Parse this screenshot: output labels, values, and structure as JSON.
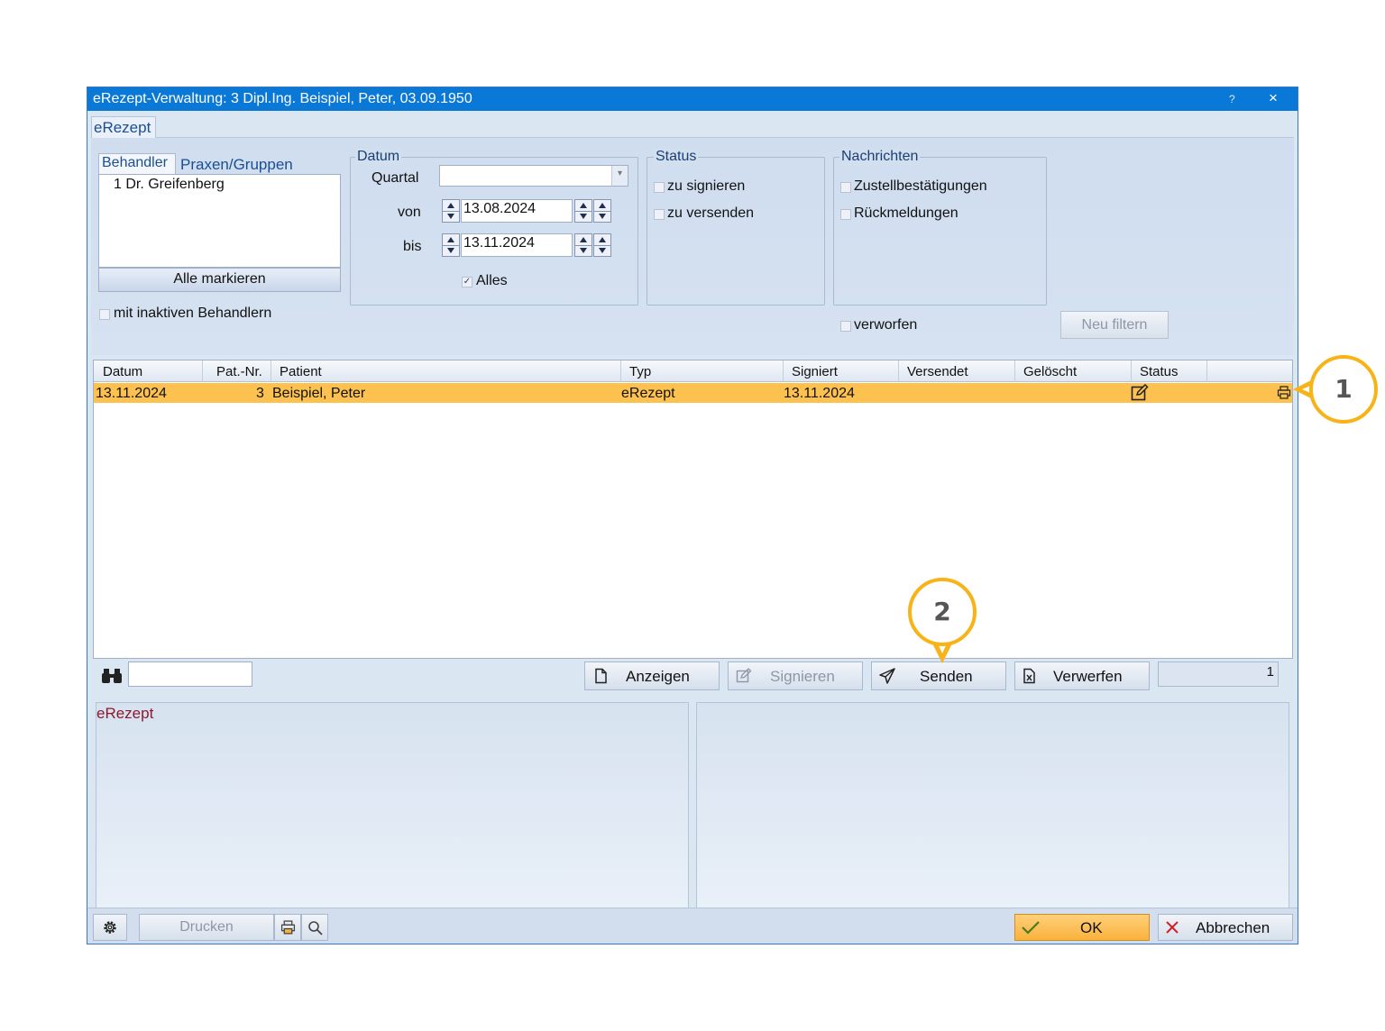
{
  "window": {
    "title": "eRezept-Verwaltung: 3 Dipl.Ing. Beispiel, Peter, 03.09.1950",
    "help": "?",
    "close": "×"
  },
  "main_tab": "eRezept",
  "behandler": {
    "tab_active": "Behandler",
    "tab_other": "Praxen/Gruppen",
    "items": [
      "1  Dr. Greifenberg"
    ],
    "select_all": "Alle markieren",
    "inactive_label": "mit inaktiven Behandlern"
  },
  "datum": {
    "legend": "Datum",
    "quartal_label": "Quartal",
    "quartal_value": "",
    "von_label": "von",
    "von_value": "13.08.2024",
    "bis_label": "bis",
    "bis_value": "13.11.2024",
    "alles_label": "Alles",
    "alles_checked": true
  },
  "status": {
    "legend": "Status",
    "options": [
      "zu signieren",
      "zu versenden"
    ]
  },
  "nachrichten": {
    "legend": "Nachrichten",
    "options": [
      "Zustellbestätigungen",
      "Rückmeldungen"
    ]
  },
  "verworfen_label": "verworfen",
  "neu_filtern": "Neu filtern",
  "table": {
    "columns": [
      "Datum",
      "Pat.-Nr.",
      "Patient",
      "Typ",
      "Signiert",
      "Versendet",
      "Gelöscht",
      "Status"
    ],
    "rows": [
      {
        "datum": "13.11.2024",
        "patnr": "3",
        "patient": "Beispiel, Peter",
        "typ": "eRezept",
        "signiert": "13.11.2024",
        "versendet": "",
        "geloescht": "",
        "status_icon": "edit-icon",
        "extra_icon": "printer-icon"
      }
    ]
  },
  "actions": {
    "anzeigen": "Anzeigen",
    "signieren": "Signieren",
    "senden": "Senden",
    "verwerfen": "Verwerfen",
    "count": "1"
  },
  "detail_title": "eRezept",
  "footer": {
    "drucken": "Drucken",
    "ok": "OK",
    "abbrechen": "Abbrechen"
  },
  "callouts": [
    "1",
    "2"
  ],
  "colors": {
    "titlebar": "#0a78d6",
    "selected_row": "#fcc14f",
    "callout_ring": "#f7b318"
  }
}
